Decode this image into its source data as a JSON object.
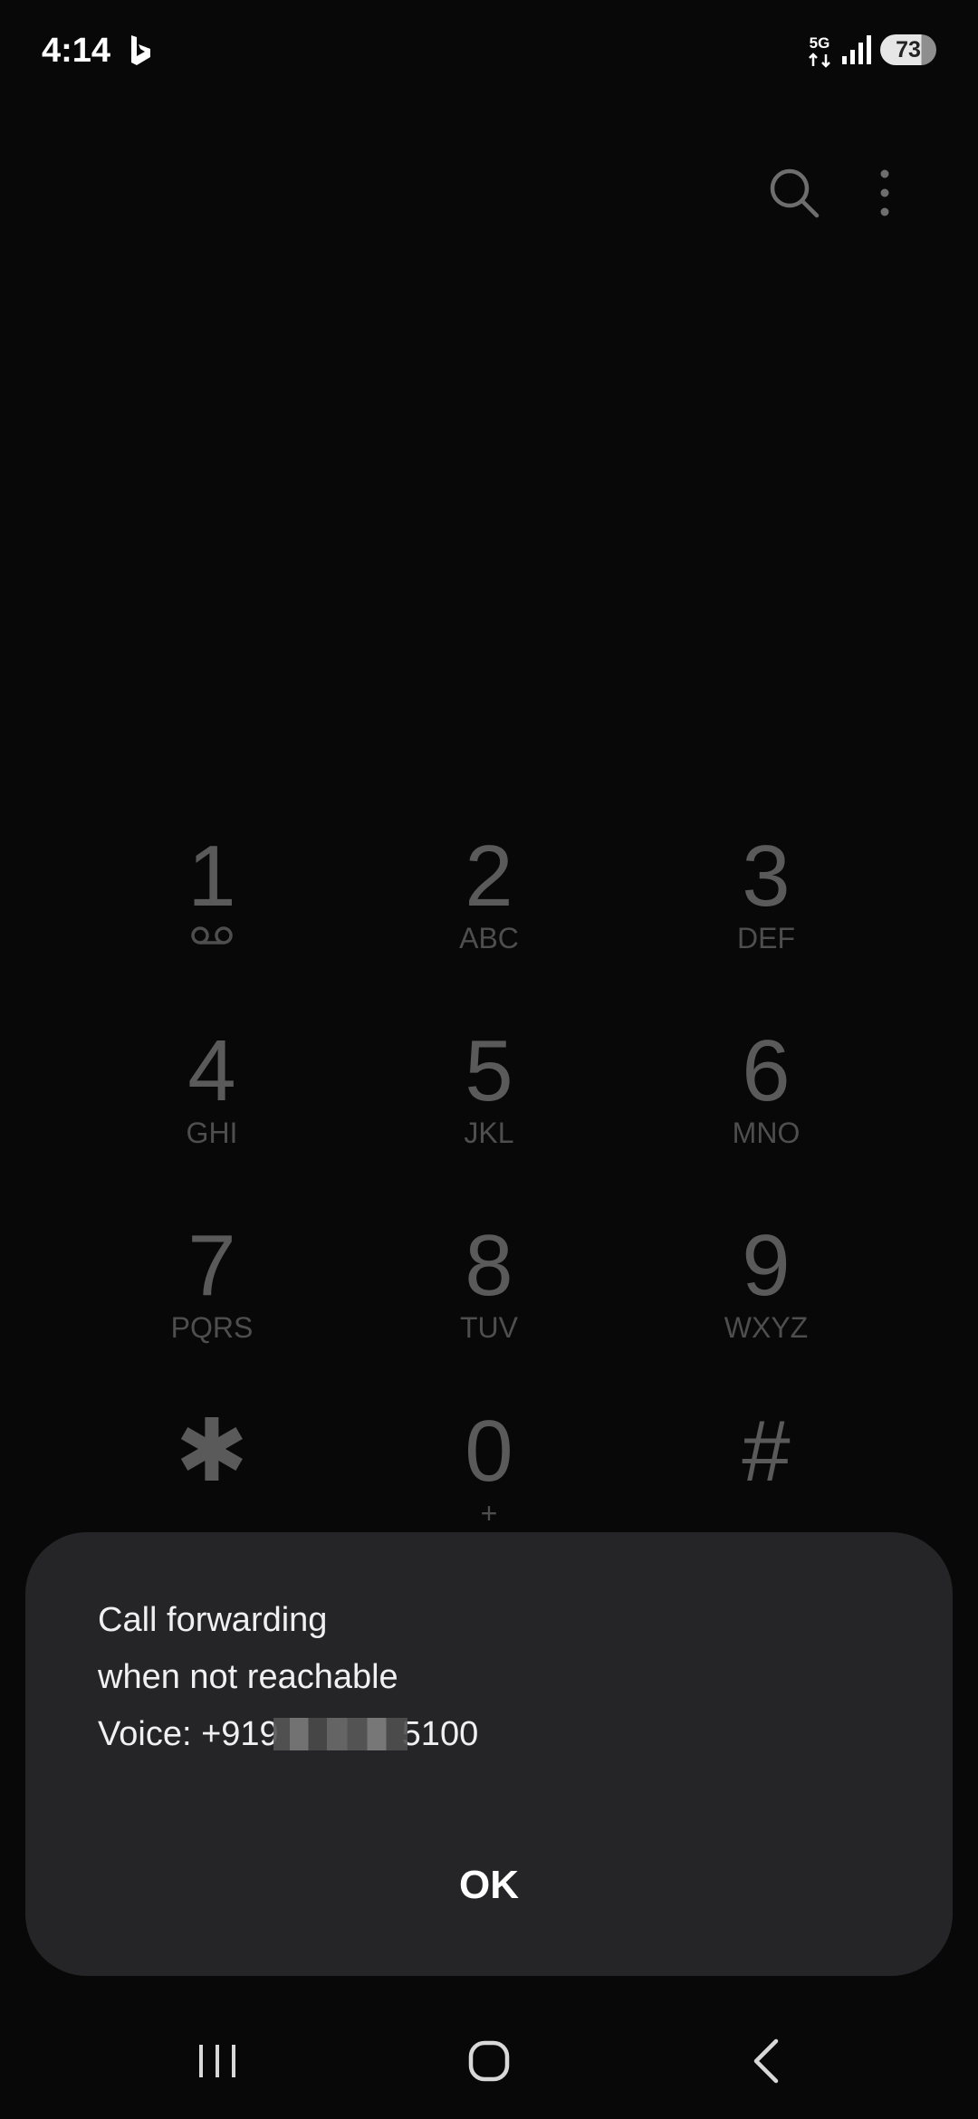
{
  "status_bar": {
    "time": "4:14",
    "network_label": "5G",
    "battery_level": "73"
  },
  "icons": {
    "app_notification": "bing-icon",
    "network": "5g-icon",
    "signal": "signal-icon",
    "battery": "battery-icon",
    "search": "search-icon",
    "more": "more-vertical-icon",
    "voicemail": "voicemail-icon",
    "nav_recents": "recents-icon",
    "nav_home": "home-icon",
    "nav_back": "back-icon"
  },
  "dialpad": {
    "keys": [
      {
        "digit": "1",
        "letters": ""
      },
      {
        "digit": "2",
        "letters": "ABC"
      },
      {
        "digit": "3",
        "letters": "DEF"
      },
      {
        "digit": "4",
        "letters": "GHI"
      },
      {
        "digit": "5",
        "letters": "JKL"
      },
      {
        "digit": "6",
        "letters": "MNO"
      },
      {
        "digit": "7",
        "letters": "PQRS"
      },
      {
        "digit": "8",
        "letters": "TUV"
      },
      {
        "digit": "9",
        "letters": "WXYZ"
      },
      {
        "digit": "✱",
        "letters": ""
      },
      {
        "digit": "0",
        "letters": "+"
      },
      {
        "digit": "#",
        "letters": ""
      }
    ]
  },
  "dialog": {
    "line1": "Call forwarding",
    "line2": "when not reachable",
    "line3_prefix": "Voice: +919",
    "line3_suffix": "5100",
    "ok_label": "OK"
  },
  "colors": {
    "background": "#080808",
    "dialog_background": "#252527",
    "dialpad_digit": "#5a5a5a",
    "text_primary": "#ffffff"
  }
}
